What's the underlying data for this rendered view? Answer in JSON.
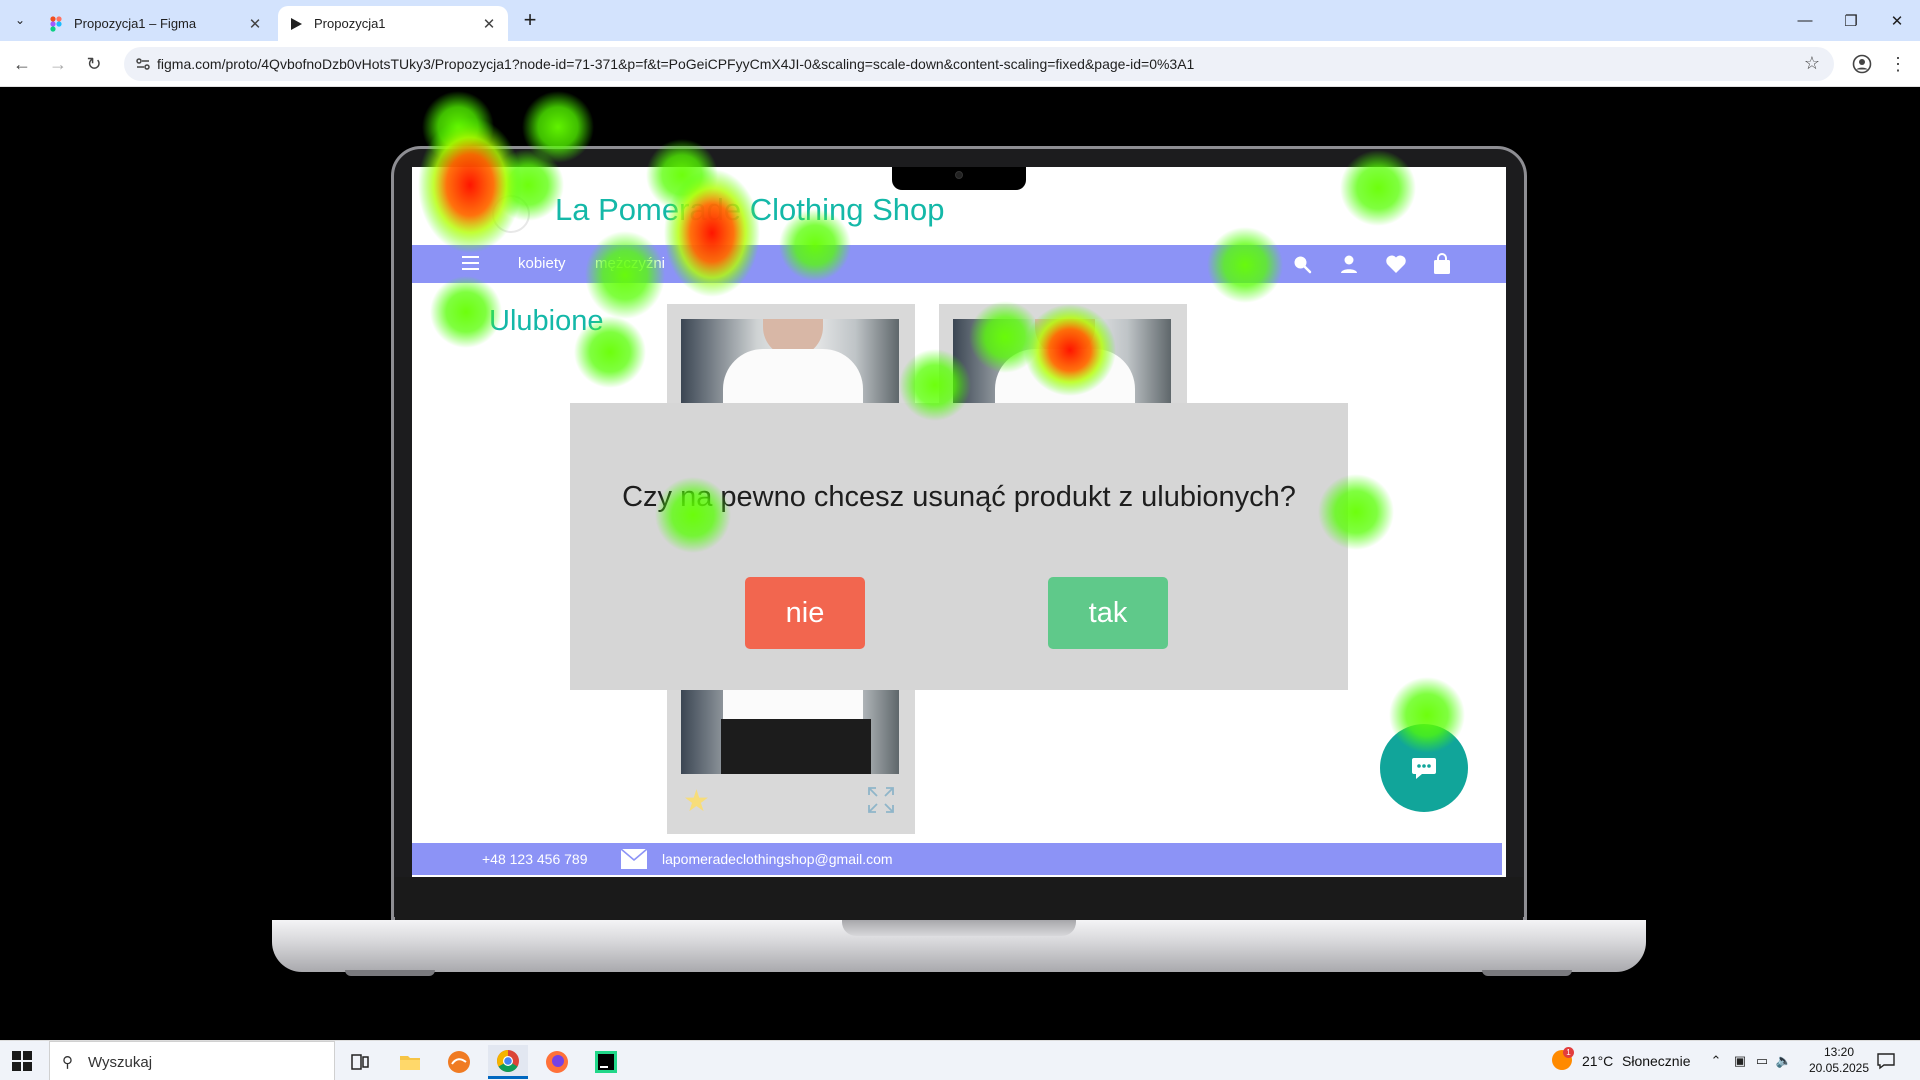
{
  "browser": {
    "tabs": [
      {
        "title": "Propozycja1 – Figma",
        "active": false,
        "icon": "figma-icon"
      },
      {
        "title": "Propozycja1",
        "active": true,
        "icon": "play-icon"
      }
    ],
    "url": "figma.com/proto/4QvbofnoDzb0vHotsTUky3/Propozycja1?node-id=71-371&p=f&t=PoGeiCPFyyCmX4JI-0&scaling=scale-down&content-scaling=fixed&page-id=0%3A1"
  },
  "site": {
    "title": "La Pomerade Clothing Shop",
    "nav": {
      "link_women": "kobiety",
      "link_men": "mężczyźni"
    },
    "page_heading": "Ulubione",
    "footer": {
      "phone": "+48 123 456 789",
      "email": "lapomeradeclothingshop@gmail.com"
    },
    "colors": {
      "accent": "#14b8a8",
      "navbar": "#8c93f6",
      "fab": "#11a59a"
    }
  },
  "dialog": {
    "question": "Czy na pewno chcesz usunąć produkt z ulubionych?",
    "no_label": "nie",
    "yes_label": "tak",
    "colors": {
      "no": "#f2664f",
      "yes": "#5fc98a",
      "backdrop": "#d6d6d6"
    }
  },
  "taskbar": {
    "search_placeholder": "Wyszukaj",
    "weather_badge": "1",
    "temperature": "21°C",
    "weather": "Słonecznie",
    "time": "13:20",
    "date": "20.05.2025",
    "apps": [
      "task-view-icon",
      "file-explorer-icon",
      "app-orange-icon",
      "chrome-icon",
      "firefox-icon",
      "pycharm-icon"
    ]
  }
}
